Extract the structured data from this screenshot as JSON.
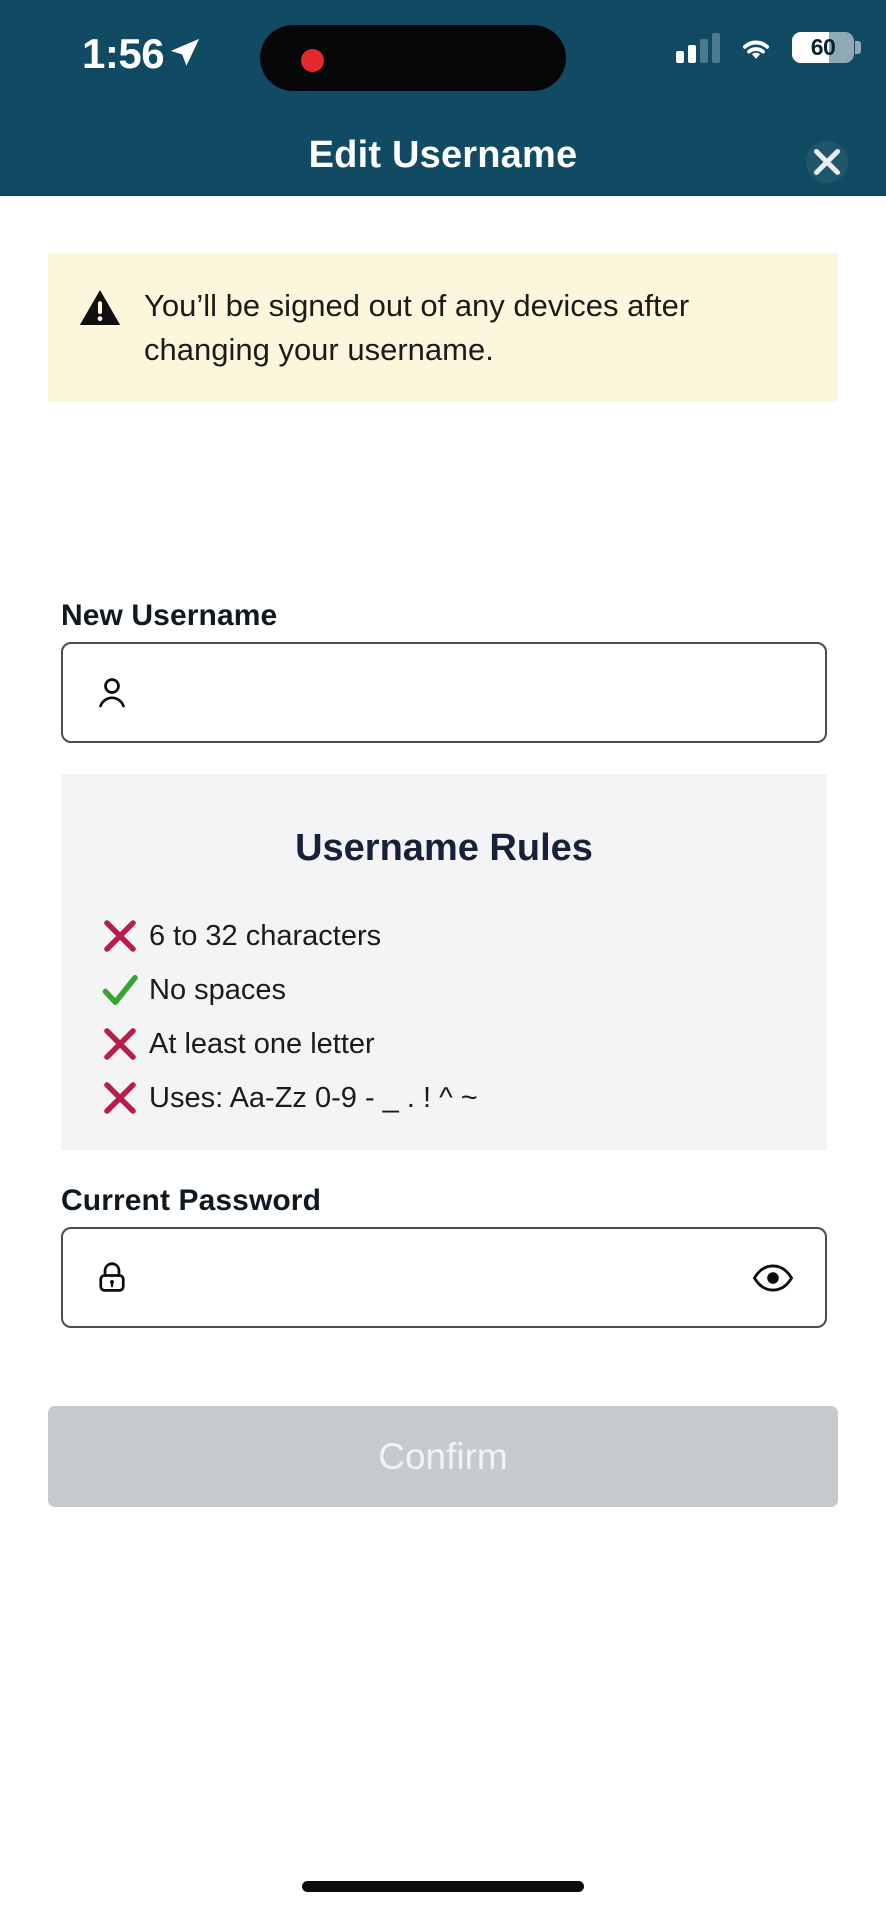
{
  "status_bar": {
    "time": "1:56",
    "location_icon": "location-arrow-icon",
    "signal_icon": "cellular-signal-icon",
    "signal_bars_filled": 2,
    "signal_bars_total": 4,
    "wifi_icon": "wifi-icon",
    "battery_level": "60",
    "battery_percent": 60,
    "recording_indicator": "red-recording-dot"
  },
  "nav": {
    "title": "Edit Username",
    "close_icon": "close-x-icon"
  },
  "warning": {
    "icon": "warning-triangle-icon",
    "text": "You’ll be signed out of any devices after changing your username.",
    "bg_color": "#FCF7DC"
  },
  "username_field": {
    "label": "New Username",
    "icon": "person-icon",
    "value": "",
    "placeholder": ""
  },
  "rules_card": {
    "title": "Username Rules",
    "items": [
      {
        "label": "6 to 32 characters",
        "status": "fail",
        "icon": "x-mark-icon"
      },
      {
        "label": "No spaces",
        "status": "pass",
        "icon": "check-mark-icon"
      },
      {
        "label": "At least one letter",
        "status": "fail",
        "icon": "x-mark-icon"
      },
      {
        "label": "Uses: Aa-Zz 0-9 - _ . ! ^ ~",
        "status": "fail",
        "icon": "x-mark-icon"
      }
    ],
    "bg_color": "#F4F4F6"
  },
  "password_field": {
    "label": "Current Password",
    "icon": "lock-icon",
    "value": "",
    "placeholder": "",
    "reveal_icon": "eye-icon"
  },
  "confirm_button": {
    "label": "Confirm",
    "enabled": false,
    "bg_color": "#C6CACE"
  },
  "colors": {
    "header": "#114A63",
    "fail": "#B81E48",
    "pass": "#36A430",
    "title_navy": "#17213A"
  }
}
